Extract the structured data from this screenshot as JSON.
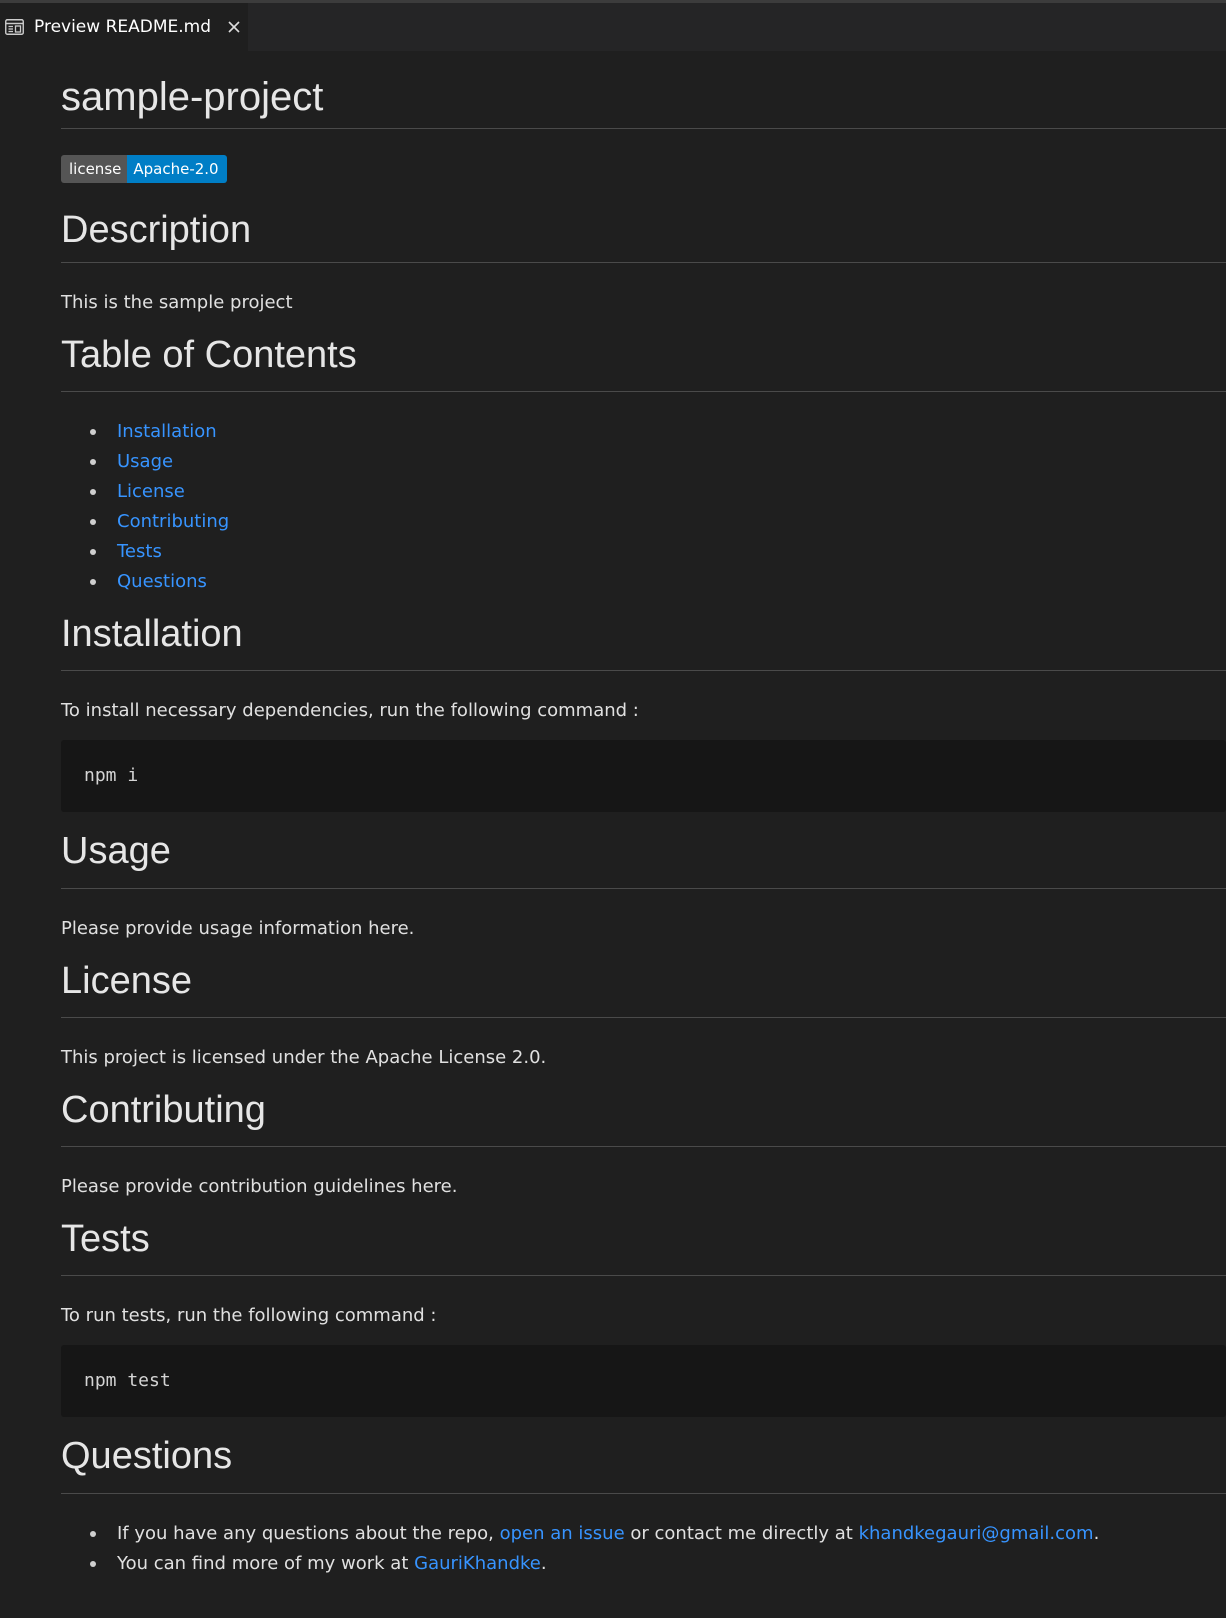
{
  "tab": {
    "icon": "preview-icon",
    "label": "Preview README.md",
    "close_icon": "close-icon"
  },
  "doc": {
    "title": "sample-project",
    "badge": {
      "left": "license",
      "right": "Apache-2.0"
    },
    "description": {
      "heading": "Description",
      "text": "This is the sample project"
    },
    "toc": {
      "heading": "Table of Contents",
      "items": [
        "Installation",
        "Usage",
        "License",
        "Contributing",
        "Tests",
        "Questions"
      ]
    },
    "installation": {
      "heading": "Installation",
      "text": "To install necessary dependencies, run the following command :",
      "code": "npm i"
    },
    "usage": {
      "heading": "Usage",
      "text": "Please provide usage information here."
    },
    "license": {
      "heading": "License",
      "text": "This project is licensed under the Apache License 2.0."
    },
    "contributing": {
      "heading": "Contributing",
      "text": "Please provide contribution guidelines here."
    },
    "tests": {
      "heading": "Tests",
      "text": "To run tests, run the following command :",
      "code": "npm test"
    },
    "questions": {
      "heading": "Questions",
      "line1_prefix": "If you have any questions about the repo, ",
      "line1_link1": "open an issue",
      "line1_middle": " or contact me directly at ",
      "line1_link2": "khandkegauri@gmail.com",
      "line1_suffix": ".",
      "line2_prefix": "You can find more of my work at ",
      "line2_link": "GauriKhandke",
      "line2_suffix": "."
    }
  }
}
